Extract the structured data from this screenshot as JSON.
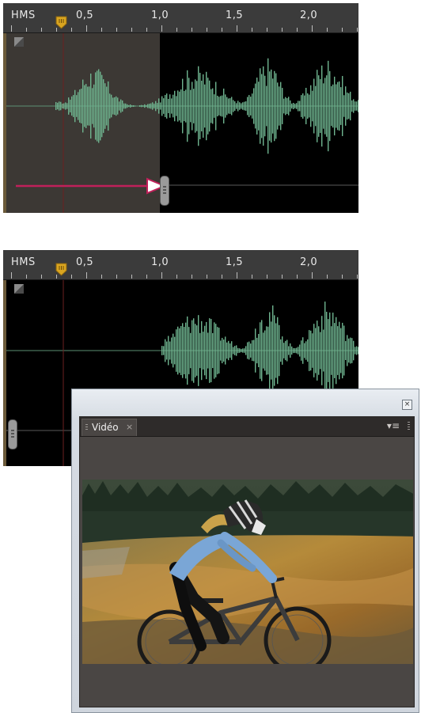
{
  "timeline_top": {
    "ruler": {
      "unit_label": "HMS",
      "ticks": [
        "0,5",
        "1,0",
        "1,5",
        "2,0"
      ]
    }
  },
  "timeline_bottom": {
    "ruler": {
      "unit_label": "HMS",
      "ticks": [
        "0,5",
        "1,0",
        "1,5",
        "2,0"
      ]
    }
  },
  "video_panel": {
    "tab_label": "Vidéo",
    "tab_close": "×",
    "panel_close": "×",
    "menu_icon": "▾≡"
  },
  "colors": {
    "waveform": "#6fb48f",
    "selection_region": "#3c3834",
    "arrow": "#c0205a",
    "playhead_marker": "#d9a520",
    "ruler_bg": "#3b3b3b"
  },
  "icons": [
    "playhead-marker-icon",
    "track-corner-icon",
    "resize-handle-icon",
    "arrow-icon",
    "close-icon",
    "panel-menu-icon",
    "gripper-icon"
  ]
}
